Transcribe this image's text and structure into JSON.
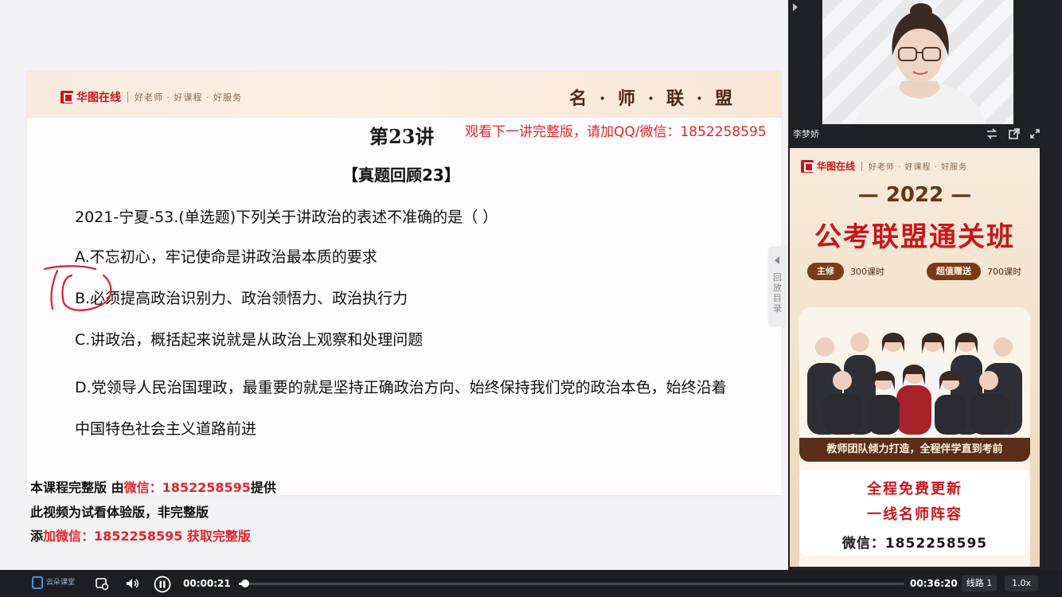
{
  "slide": {
    "brand_name": "华图在线",
    "brand_slogan": "好老师 · 好课程 · 好服务",
    "header_right": "名 · 师 · 联 · 盟",
    "lecture_title": "第23讲",
    "watermark_top": "观看下一讲完整版，请加QQ/微信：1852258595",
    "section_title": "【真题回顾23】",
    "question": "2021-宁夏-53.(单选题)下列关于讲政治的表述不准确的是（  ）",
    "options": [
      "A.不忘初心，牢记使命是讲政治最本质的要求",
      "B.必须提高政治识别力、政治领悟力、政治执行力",
      "C.讲政治，概括起来说就是从政治上观察和处理问题",
      "D.党领导人民治国理政，最重要的就是坚持正确政治方向、始终保持我们党的政治本色，始终沿着中国特色社会主义道路前进"
    ],
    "marked_option": "B",
    "collapse_tab_label": "回放目录"
  },
  "watermark": {
    "line1_prefix": "本课程完整版 由",
    "line1_red": "微信：1852258595",
    "line1_suffix": "提供",
    "line2": "此视频为试看体验版，非完整版",
    "line3_prefix": "添",
    "line3_red": "加微信：1852258595 获取完整版"
  },
  "teacher": {
    "name": "李梦娇"
  },
  "ad": {
    "brand_name": "华图在线",
    "brand_slogan": "好老师 · 好课程 · 好服务",
    "year": "— 2022 —",
    "title": "公考联盟通关班",
    "pill1_tag": "主修",
    "pill1_value": "300课时",
    "pill2_tag": "超值赠送",
    "pill2_value": "700课时",
    "slogan": "教师团队倾力打造，全程伴学直到考前",
    "free_update": "全程免费更新",
    "teachers": "一线名师阵容",
    "wechat": "微信：1852258595"
  },
  "player": {
    "logo_text": "云朵课堂",
    "time_current": "00:00:21",
    "time_total": "00:36:20",
    "progress": 0.0096,
    "line_label": "线路 1",
    "speed_label": "1.0x"
  },
  "colors": {
    "accent_red": "#e0262b",
    "brand_red": "#c8161d",
    "player_bar": "#1d1e22",
    "ad_brown": "#5a2e18"
  }
}
